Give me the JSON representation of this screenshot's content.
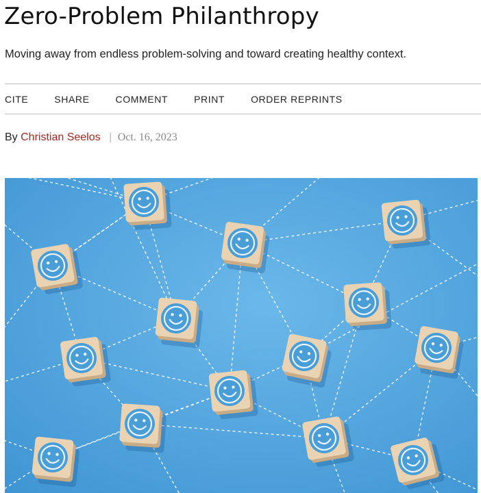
{
  "article": {
    "title": "Zero-Problem Philanthropy",
    "subtitle": "Moving away from endless problem-solving and toward creating healthy context."
  },
  "toolbar": {
    "items": [
      {
        "label": "CITE"
      },
      {
        "label": "SHARE"
      },
      {
        "label": "COMMENT"
      },
      {
        "label": "PRINT"
      },
      {
        "label": "ORDER REPRINTS"
      }
    ]
  },
  "byline": {
    "prefix": "By",
    "author": "Christian Seelos",
    "separator": "|",
    "date": "Oct. 16, 2023"
  },
  "colors": {
    "accent_author": "#a6261d",
    "hero_background": "#5aa9e0",
    "cube_face": "#e9d3b3",
    "smiley_blue": "#4a9ed8"
  },
  "hero": {
    "icon": "smiley-face-cubes-network"
  }
}
